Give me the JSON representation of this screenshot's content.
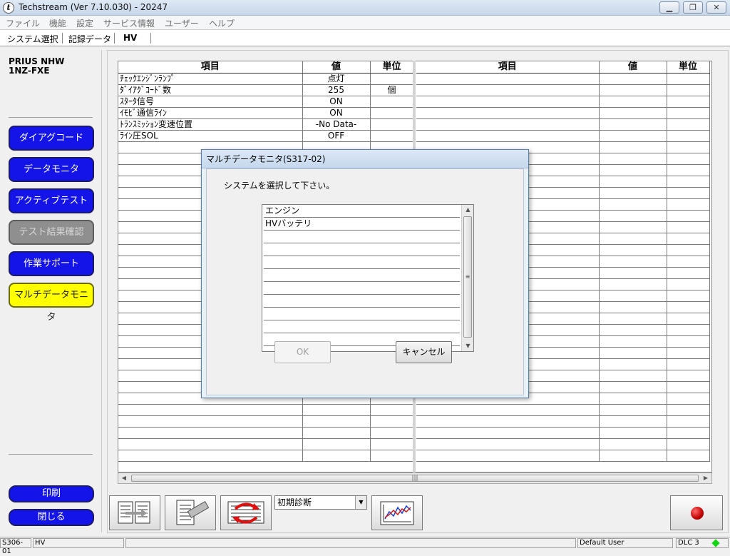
{
  "window": {
    "title": "Techstream (Ver 7.10.030) - 20247",
    "icon_name": "techstream-app-icon",
    "controls": [
      "minimize",
      "maximize",
      "close"
    ]
  },
  "menu": [
    "ファイル",
    "機能",
    "設定",
    "サービス情報",
    "ユーザー",
    "ヘルプ"
  ],
  "tabs": [
    "システム選択",
    "記録データ",
    "HV"
  ],
  "vehicle": {
    "model": "PRIUS NHW",
    "engine": "1NZ-FXE"
  },
  "sidebar": {
    "buttons": [
      {
        "label": "ダイアグコード",
        "state": "enabled"
      },
      {
        "label": "データモニタ",
        "state": "enabled"
      },
      {
        "label": "アクティブテスト",
        "state": "enabled"
      },
      {
        "label": "テスト結果確認",
        "state": "disabled"
      },
      {
        "label": "作業サポート",
        "state": "enabled"
      },
      {
        "label": "マルチデータモニタ",
        "state": "active"
      }
    ],
    "bottom_buttons": [
      {
        "label": "印刷"
      },
      {
        "label": "閉じる"
      }
    ],
    "colors": {
      "button_blue": "#1414e8",
      "button_active": "#ffff00",
      "button_disabled": "#8f8f8f"
    }
  },
  "table": {
    "headers": [
      "項目",
      "値",
      "単位"
    ],
    "rows": [
      [
        "ﾁｪｯｸｴﾝｼﾞﾝﾗﾝﾌﾟ",
        "点灯",
        ""
      ],
      [
        "ﾀﾞｲｱｸﾞｺｰﾄﾞ数",
        "255",
        "個"
      ],
      [
        "ｽﾀｰﾀ信号",
        "ON",
        ""
      ],
      [
        "ｲﾓﾋﾞ通信ﾗｲﾝ",
        "ON",
        ""
      ],
      [
        "ﾄﾗﾝｽﾐｯｼｮﾝ変速位置",
        "-No Data-",
        ""
      ],
      [
        "ﾗｲﾝ圧SOL",
        "OFF",
        ""
      ]
    ]
  },
  "toolbar": {
    "dropdown_value": "初期診断",
    "buttons": [
      "table-layout-icon",
      "record-clipboard-icon",
      "switch-arrows-icon",
      "graph-icon",
      "record-icon"
    ]
  },
  "status": {
    "screen_code": "S306-01",
    "system": "HV",
    "user": "Default User",
    "connection": "DLC 3",
    "connection_color": "#14d414"
  },
  "dialog": {
    "title": "マルチデータモニタ(S317-02)",
    "prompt": "システムを選択して下さい。",
    "options": [
      "エンジン",
      "HVバッテリ"
    ],
    "ok_label": "OK",
    "cancel_label": "キャンセル"
  }
}
